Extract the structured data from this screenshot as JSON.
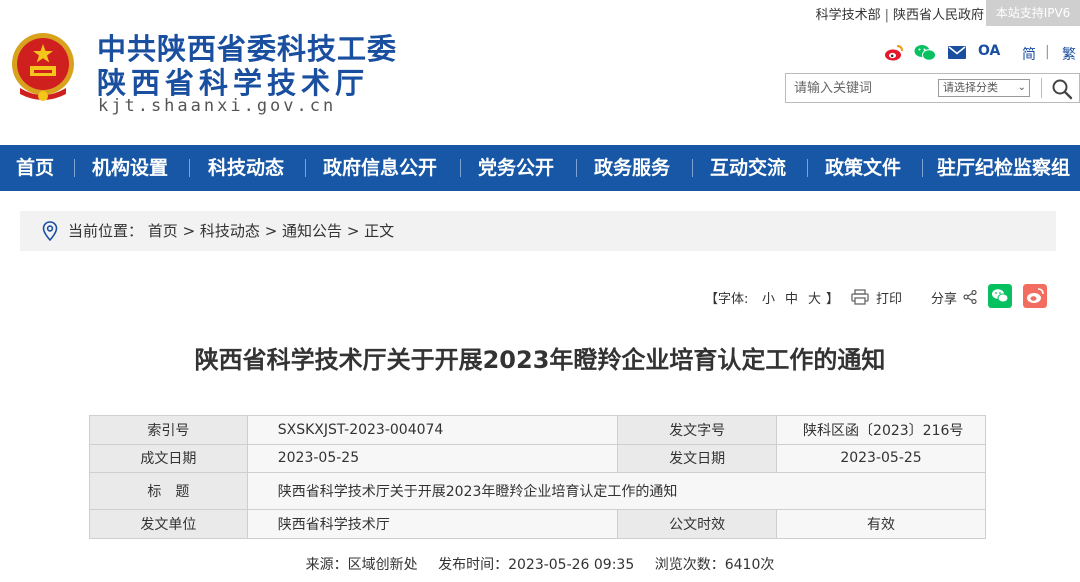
{
  "header": {
    "title_line1": "中共陕西省委科技工委",
    "title_line2": "陕西省科学技术厅",
    "domain": "kjt.shaanxi.gov.cn",
    "top_links": [
      "科学技术部",
      "陕西省人民政府"
    ],
    "ipv6_badge": "本站支持IPV6",
    "lang_simplified": "简",
    "lang_traditional": "繁",
    "icons": [
      "weibo-icon",
      "wechat-icon",
      "mail-icon",
      "oa-icon"
    ],
    "oa_label": "OA",
    "search": {
      "placeholder": "请输入关键词",
      "category_selected": "请选择分类"
    }
  },
  "nav": {
    "items": [
      "首页",
      "机构设置",
      "科技动态",
      "政府信息公开",
      "党务公开",
      "政务服务",
      "互动交流",
      "政策文件",
      "驻厅纪检监察组"
    ]
  },
  "breadcrumb": {
    "prefix": "当前位置：",
    "path": [
      "首页",
      "科技动态",
      "通知公告",
      "正文"
    ],
    "separator": " > "
  },
  "tools": {
    "font_label": "【字体:",
    "font_small": "小",
    "font_medium": "中",
    "font_large": "大",
    "font_close": "】",
    "print_label": "打印",
    "share_label": "分享"
  },
  "article": {
    "title": "陕西省科学技术厅关于开展2023年瞪羚企业培育认定工作的通知",
    "meta": {
      "index_label": "索引号",
      "index_value": "SXSKXJST-2023-004074",
      "doc_no_label": "发文字号",
      "doc_no_value": "陕科区函〔2023〕216号",
      "created_label": "成文日期",
      "created_value": "2023-05-25",
      "issued_label": "发文日期",
      "issued_value": "2023-05-25",
      "subject_label": "标　题",
      "subject_value": "陕西省科学技术厅关于开展2023年瞪羚企业培育认定工作的通知",
      "issuer_label": "发文单位",
      "issuer_value": "陕西省科学技术厅",
      "validity_label": "公文时效",
      "validity_value": "有效"
    },
    "source": "来源：区域创新处",
    "publish_time": "发布时间：2023-05-26 09:35",
    "views": "浏览次数：6410次"
  },
  "colors": {
    "nav_bg": "#1757a5",
    "title_blue": "#1a4fa0",
    "weibo": "#e6162d",
    "wechat": "#07c160"
  }
}
